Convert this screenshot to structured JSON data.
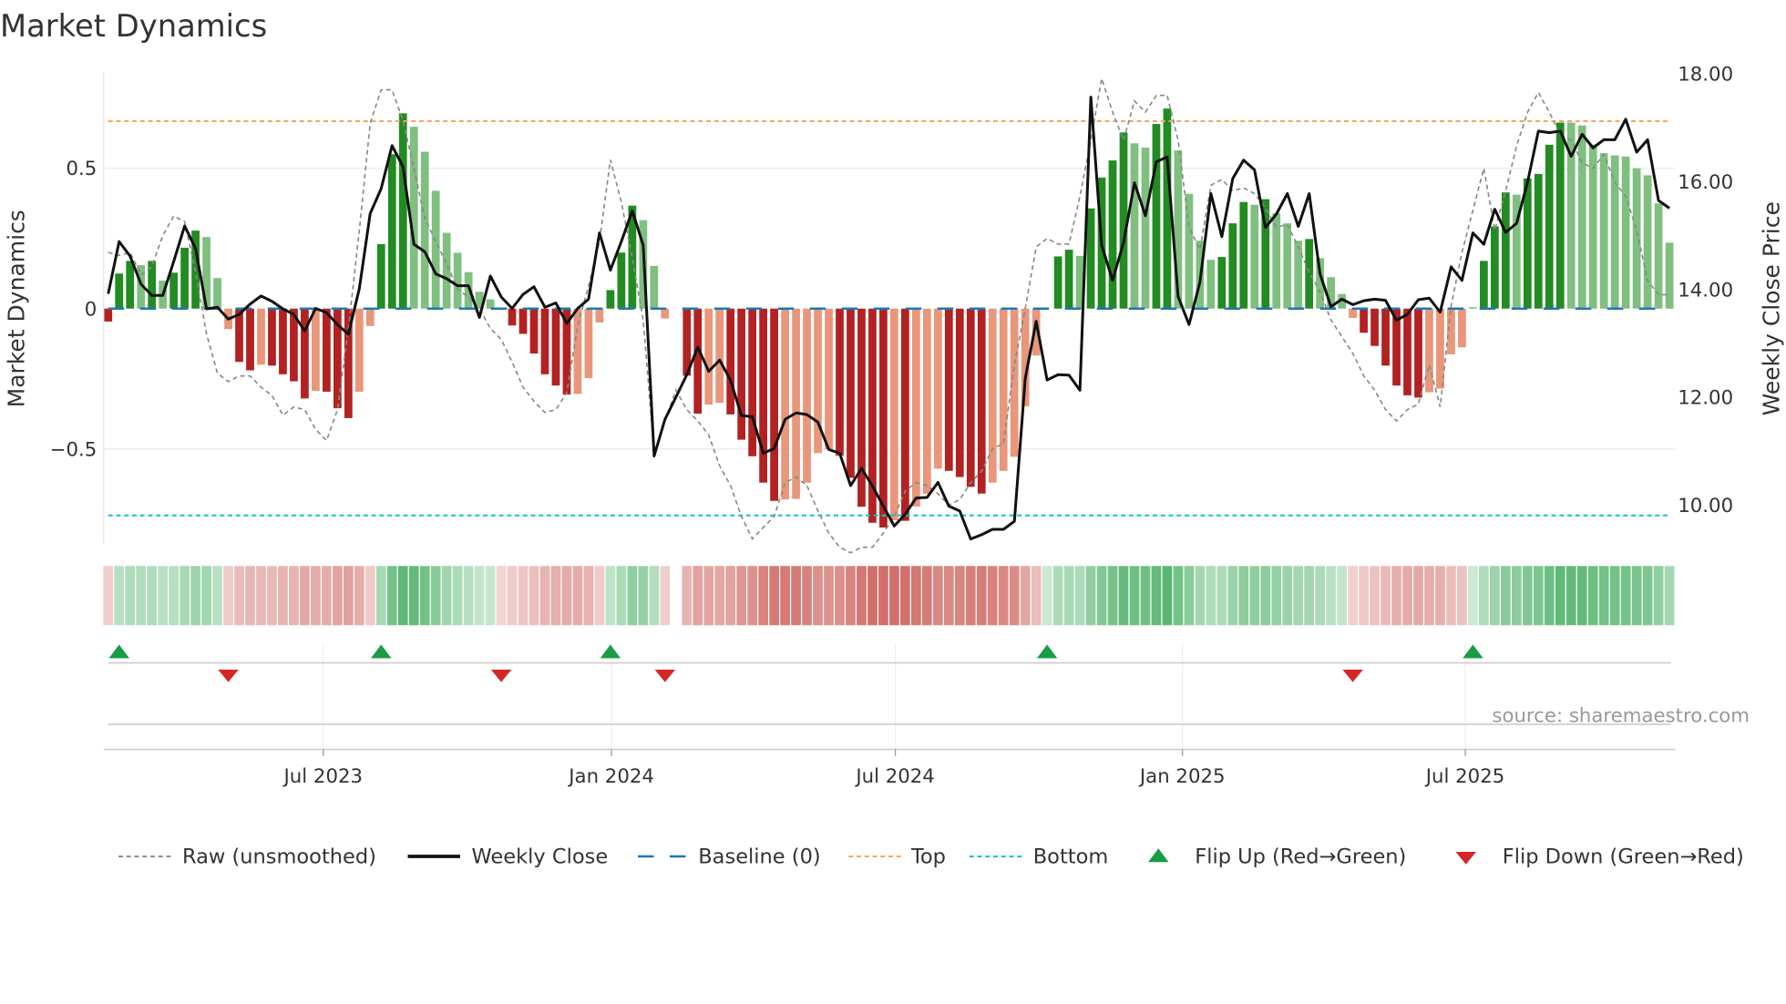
{
  "title": "Market Dynamics",
  "source": "source: sharemaestro.com",
  "colors": {
    "green_dark": "#228b22",
    "green_light": "#7fbf7f",
    "red_dark": "#b22222",
    "red_light": "#e9967a",
    "close": "#111111",
    "raw": "#888888",
    "baseline": "#1f77b4",
    "top": "#f4a460",
    "bottom": "#17becf",
    "flip_up": "#1a9c47",
    "flip_down": "#d62728"
  },
  "chart_data": {
    "type": "bar",
    "title": "Market Dynamics",
    "ylabel": "Market Dynamics",
    "y2label": "Weekly Close Price",
    "ylim": [
      -0.84,
      0.84
    ],
    "y2lim": [
      9.27,
      18.02
    ],
    "yticks": [
      {
        "v": 0.5,
        "label": "0.5"
      },
      {
        "v": 0,
        "label": "0"
      },
      {
        "v": -0.5,
        "label": "−0.5"
      }
    ],
    "y2ticks": [
      {
        "v": 18,
        "label": "18.00"
      },
      {
        "v": 16,
        "label": "16.00"
      },
      {
        "v": 14,
        "label": "14.00"
      },
      {
        "v": 12,
        "label": "12.00"
      },
      {
        "v": 10,
        "label": "10.00"
      }
    ],
    "xticks": [
      {
        "week": 19.7,
        "label": "Jul 2023"
      },
      {
        "week": 46.1,
        "label": "Jan 2024"
      },
      {
        "week": 72.1,
        "label": "Jul 2024"
      },
      {
        "week": 98.4,
        "label": "Jan 2025"
      },
      {
        "week": 124.3,
        "label": "Jul 2025"
      }
    ],
    "top_level": 0.668,
    "bottom_level": -0.737,
    "baseline": 0,
    "dynamics": [
      -0.046,
      0.125,
      0.17,
      0.155,
      0.17,
      0.1,
      0.128,
      0.217,
      0.278,
      0.255,
      0.109,
      -0.073,
      -0.19,
      -0.22,
      -0.2,
      -0.203,
      -0.234,
      -0.259,
      -0.32,
      -0.293,
      -0.296,
      -0.355,
      -0.39,
      -0.296,
      -0.062,
      0.23,
      0.55,
      0.696,
      0.648,
      0.559,
      0.42,
      0.27,
      0.199,
      0.13,
      0.06,
      0.033,
      -0.003,
      -0.06,
      -0.09,
      -0.16,
      -0.234,
      -0.274,
      -0.306,
      -0.304,
      -0.248,
      -0.049,
      0.066,
      0.2,
      0.367,
      0.315,
      0.152,
      -0.035,
      0,
      -0.239,
      -0.374,
      -0.342,
      -0.336,
      -0.377,
      -0.467,
      -0.526,
      -0.62,
      -0.685,
      -0.68,
      -0.678,
      -0.62,
      -0.515,
      -0.502,
      -0.524,
      -0.603,
      -0.706,
      -0.763,
      -0.78,
      -0.754,
      -0.756,
      -0.705,
      -0.66,
      -0.57,
      -0.578,
      -0.6,
      -0.635,
      -0.659,
      -0.62,
      -0.578,
      -0.528,
      -0.348,
      -0.167,
      0,
      0.186,
      0.21,
      0.188,
      0.357,
      0.467,
      0.528,
      0.628,
      0.589,
      0.574,
      0.658,
      0.713,
      0.564,
      0.409,
      0.242,
      0.174,
      0.184,
      0.304,
      0.38,
      0.37,
      0.39,
      0.34,
      0.304,
      0.242,
      0.248,
      0.18,
      0.112,
      0.052,
      -0.033,
      -0.086,
      -0.133,
      -0.203,
      -0.274,
      -0.309,
      -0.317,
      -0.298,
      -0.285,
      -0.163,
      -0.138,
      0.005,
      0.17,
      0.293,
      0.414,
      0.406,
      0.464,
      0.48,
      0.584,
      0.663,
      0.663,
      0.653,
      0.585,
      0.554,
      0.546,
      0.542,
      0.5,
      0.475,
      0.375,
      0.235
    ],
    "raw": [
      0.2,
      0.19,
      0.2,
      0.12,
      0.15,
      0.26,
      0.33,
      0.31,
      0.13,
      -0.09,
      -0.23,
      -0.26,
      -0.24,
      -0.24,
      -0.28,
      -0.31,
      -0.38,
      -0.35,
      -0.36,
      -0.43,
      -0.47,
      -0.36,
      -0.07,
      0.28,
      0.66,
      0.78,
      0.78,
      0.67,
      0.5,
      0.32,
      0.24,
      0.16,
      0.07,
      0.04,
      0.0,
      -0.07,
      -0.11,
      -0.19,
      -0.28,
      -0.33,
      -0.37,
      -0.36,
      -0.3,
      -0.06,
      0.08,
      0.24,
      0.53,
      0.38,
      0.18,
      -0.04,
      -0.52,
      -0.4,
      -0.29,
      -0.36,
      -0.4,
      -0.45,
      -0.56,
      -0.63,
      -0.74,
      -0.82,
      -0.78,
      -0.74,
      -0.62,
      -0.6,
      -0.63,
      -0.72,
      -0.8,
      -0.85,
      -0.87,
      -0.85,
      -0.85,
      -0.8,
      -0.74,
      -0.65,
      -0.62,
      -0.63,
      -0.66,
      -0.7,
      -0.68,
      -0.62,
      -0.58,
      -0.5,
      -0.48,
      -0.2,
      0.0,
      0.22,
      0.25,
      0.23,
      0.23,
      0.4,
      0.6,
      0.82,
      0.7,
      0.6,
      0.74,
      0.7,
      0.76,
      0.76,
      0.6,
      0.29,
      0.21,
      0.44,
      0.46,
      0.42,
      0.43,
      0.41,
      0.36,
      0.29,
      0.3,
      0.22,
      0.13,
      0.06,
      -0.04,
      -0.1,
      -0.16,
      -0.24,
      -0.29,
      -0.36,
      -0.4,
      -0.36,
      -0.34,
      -0.2,
      -0.35,
      0.01,
      0.2,
      0.35,
      0.5,
      0.28,
      0.42,
      0.58,
      0.7,
      0.77,
      0.7,
      0.62,
      0.6,
      0.52,
      0.5,
      0.55,
      0.45,
      0.4,
      0.28,
      0.1,
      0.05,
      0.05
    ],
    "close": [
      13.92,
      14.89,
      14.62,
      14.1,
      13.89,
      13.89,
      14.52,
      15.18,
      14.76,
      13.64,
      13.67,
      13.45,
      13.54,
      13.73,
      13.88,
      13.78,
      13.64,
      13.54,
      13.23,
      13.65,
      13.57,
      13.35,
      13.17,
      14.02,
      15.41,
      15.87,
      16.67,
      16.28,
      14.84,
      14.7,
      14.29,
      14.2,
      14.07,
      14.07,
      13.48,
      14.25,
      13.86,
      13.65,
      13.91,
      14.05,
      13.67,
      13.75,
      13.37,
      13.65,
      13.82,
      15.05,
      14.36,
      14.89,
      15.46,
      14.82,
      10.91,
      11.59,
      12.0,
      12.42,
      12.93,
      12.48,
      12.69,
      12.32,
      11.66,
      11.64,
      10.96,
      11.05,
      11.59,
      11.71,
      11.68,
      11.54,
      11.03,
      10.96,
      10.36,
      10.68,
      10.35,
      9.98,
      9.61,
      9.83,
      10.13,
      10.14,
      10.42,
      9.98,
      9.89,
      9.37,
      9.45,
      9.55,
      9.55,
      9.7,
      12.35,
      13.41,
      12.32,
      12.42,
      12.41,
      12.13,
      17.57,
      14.82,
      14.17,
      14.87,
      15.98,
      15.37,
      16.37,
      16.46,
      13.87,
      13.35,
      14.14,
      15.78,
      14.98,
      16.06,
      16.4,
      16.22,
      15.15,
      15.4,
      15.78,
      15.17,
      15.78,
      14.29,
      13.68,
      13.82,
      13.72,
      13.79,
      13.82,
      13.8,
      13.43,
      13.54,
      13.81,
      13.84,
      13.58,
      14.42,
      14.17,
      15.05,
      14.84,
      15.49,
      15.06,
      15.23,
      15.99,
      16.94,
      16.91,
      16.94,
      16.47,
      16.88,
      16.63,
      16.78,
      16.78,
      17.16,
      16.55,
      16.78,
      15.65,
      15.51
    ],
    "heatmap_gap_weeks": [
      52
    ],
    "flip_up_weeks": [
      1,
      25,
      46,
      86,
      125
    ],
    "flip_down_weeks": [
      11,
      36,
      51,
      114
    ],
    "legend": {
      "placement": "bottom",
      "items": [
        {
          "key": "raw",
          "label": "Raw (unsmoothed)"
        },
        {
          "key": "close",
          "label": "Weekly Close"
        },
        {
          "key": "baseline",
          "label": "Baseline (0)"
        },
        {
          "key": "top",
          "label": "Top"
        },
        {
          "key": "bottom",
          "label": "Bottom"
        },
        {
          "key": "flip_up",
          "label": "Flip Up (Red→Green)"
        },
        {
          "key": "flip_down",
          "label": "Flip Down (Green→Red)"
        }
      ]
    }
  }
}
